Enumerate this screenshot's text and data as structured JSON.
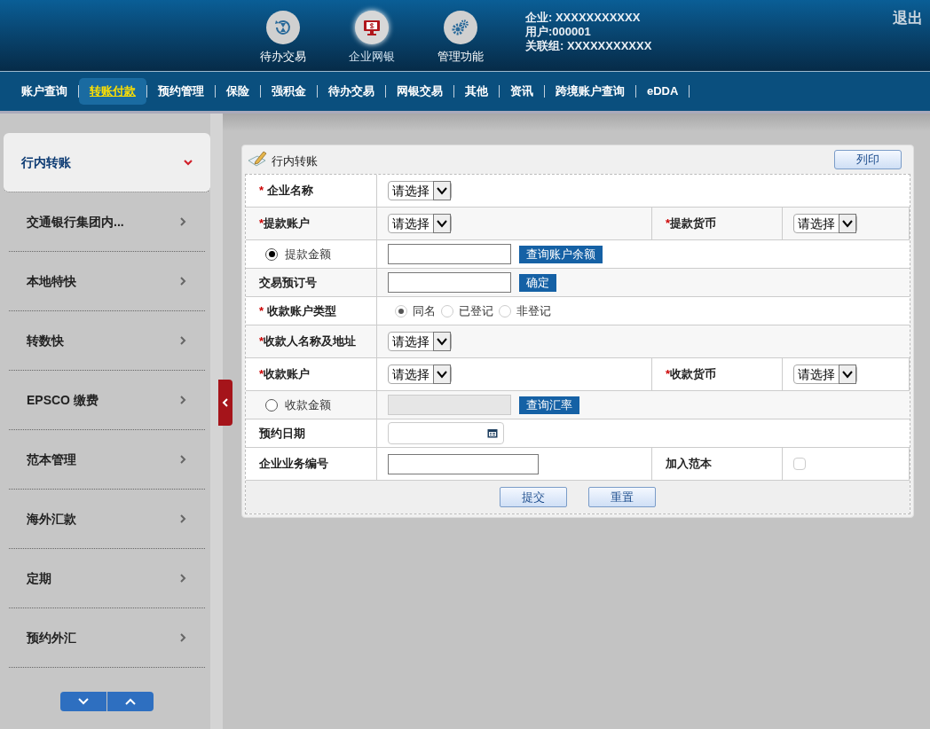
{
  "header": {
    "apps": [
      {
        "label": "待办交易",
        "kind": "pending",
        "selected": false
      },
      {
        "label": "企业网银",
        "kind": "ebank",
        "selected": true
      },
      {
        "label": "管理功能",
        "kind": "manage",
        "selected": false
      }
    ],
    "info": [
      "企业: XXXXXXXXXXX",
      "用户:000001",
      "关联组: XXXXXXXXXXX"
    ],
    "logout": "退出"
  },
  "nav": [
    {
      "label": "账户查询",
      "selected": false
    },
    {
      "label": "转账付款",
      "selected": true
    },
    {
      "label": "预约管理",
      "selected": false
    },
    {
      "label": "保险",
      "selected": false
    },
    {
      "label": "强积金",
      "selected": false
    },
    {
      "label": "待办交易",
      "selected": false
    },
    {
      "label": "网银交易",
      "selected": false
    },
    {
      "label": "其他",
      "selected": false
    },
    {
      "label": "资讯",
      "selected": false
    },
    {
      "label": "跨境账户查询",
      "selected": false
    },
    {
      "label": "eDDA",
      "selected": false
    }
  ],
  "sidebar": {
    "items": [
      {
        "label": "行内转账",
        "selected": true
      },
      {
        "label": "交通银行集团内...",
        "selected": false
      },
      {
        "label": "本地特快",
        "selected": false
      },
      {
        "label": "转数快",
        "selected": false
      },
      {
        "label": "EPSCO 缴费",
        "selected": false
      },
      {
        "label": "范本管理",
        "selected": false
      },
      {
        "label": "海外汇款",
        "selected": false
      },
      {
        "label": "定期",
        "selected": false
      },
      {
        "label": "预约外汇",
        "selected": false
      }
    ]
  },
  "panel": {
    "title": "行内转账",
    "print_button": "列印",
    "rows": [
      {
        "fields": [
          {
            "label": "企业名称",
            "marker": "* ",
            "control": {
              "kind": "select",
              "value": "请选择"
            }
          }
        ]
      },
      {
        "fields": [
          {
            "label": "提款账户",
            "marker": "*",
            "control": {
              "kind": "select",
              "value": "请选择"
            }
          },
          {
            "label": "提款货币",
            "marker": "*",
            "control": {
              "kind": "select",
              "value": "请选择"
            }
          }
        ]
      },
      {
        "fields": [
          {
            "label": "提款金额",
            "radio": {
              "selected": true
            },
            "control": {
              "kind": "text_button",
              "button": "查询账户余额",
              "disabled": false
            }
          }
        ]
      },
      {
        "fields": [
          {
            "label": "交易预订号",
            "control": {
              "kind": "text_button",
              "button": "确定",
              "disabled": false
            }
          }
        ]
      },
      {
        "fields": [
          {
            "label": "收款账户类型",
            "marker": "* ",
            "control": {
              "kind": "radio_group",
              "options": [
                {
                  "label": "同名",
                  "selected": true
                },
                {
                  "label": "已登记",
                  "selected": false
                },
                {
                  "label": "非登记",
                  "selected": false
                }
              ]
            }
          }
        ]
      },
      {
        "fields": [
          {
            "label": "收款人名称及地址",
            "marker": "*",
            "control": {
              "kind": "select",
              "value": "请选择"
            }
          }
        ]
      },
      {
        "fields": [
          {
            "label": "收款账户",
            "marker": "*",
            "control": {
              "kind": "select",
              "value": "请选择"
            }
          },
          {
            "label": "收款货币",
            "marker": "*",
            "control": {
              "kind": "select",
              "value": "请选择"
            }
          }
        ]
      },
      {
        "fields": [
          {
            "label": "收款金额",
            "radio": {
              "selected": false
            },
            "control": {
              "kind": "text_button",
              "button": "查询汇率",
              "disabled": true
            }
          }
        ]
      },
      {
        "fields": [
          {
            "label": "预约日期",
            "control": {
              "kind": "date"
            }
          }
        ]
      },
      {
        "fields": [
          {
            "label": "企业业务编号",
            "control": {
              "kind": "text"
            }
          },
          {
            "label": "加入范本",
            "control": {
              "kind": "checkbox",
              "checked": false
            }
          }
        ]
      }
    ],
    "buttons": [
      "提交",
      "重置"
    ]
  }
}
